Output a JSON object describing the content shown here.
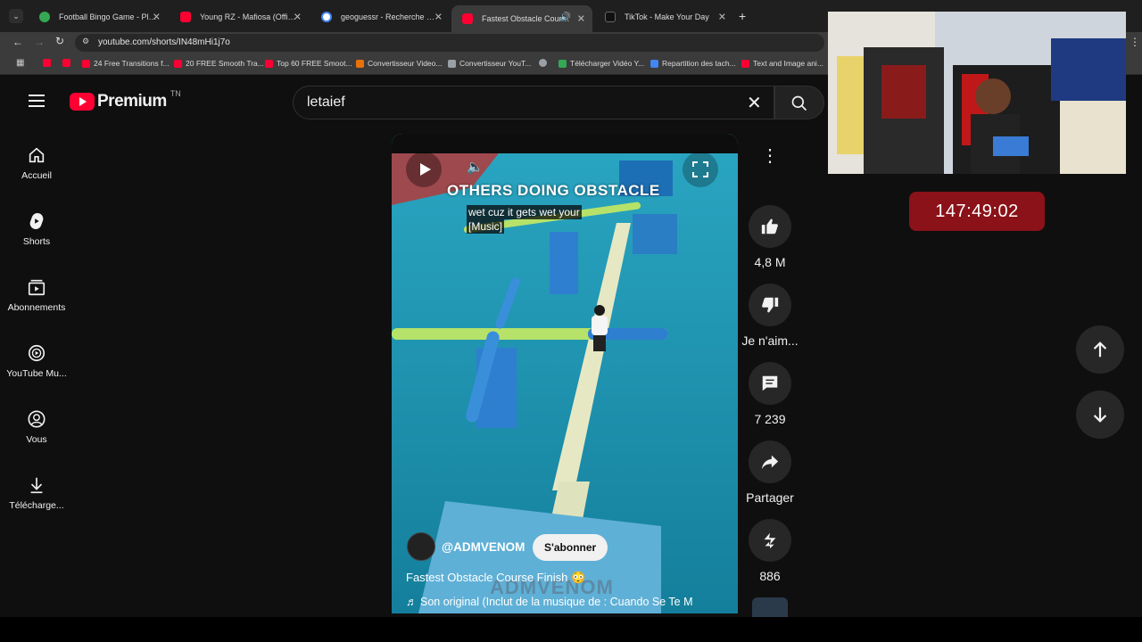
{
  "tabs": [
    {
      "label": "Football Bingo Game - Play No",
      "color": "#34a853"
    },
    {
      "label": "Young RZ - Mafiosa (Official M",
      "color": "#ff0033"
    },
    {
      "label": "geoguessr - Recherche Google",
      "color": "#4285f4"
    },
    {
      "label": "Fastest Obstacle Course Fini",
      "color": "#ff0033"
    },
    {
      "label": "TikTok - Make Your Day",
      "color": "#000000"
    }
  ],
  "address": {
    "url": "youtube.com/shorts/IN48mHi1j7o"
  },
  "bookmarks": [
    {
      "label": "",
      "color": "#ff0033"
    },
    {
      "label": "",
      "color": "#ff0033"
    },
    {
      "label": "24 Free Transitions f...",
      "color": "#ff0033"
    },
    {
      "label": "20 FREE Smooth Tra...",
      "color": "#ff0033"
    },
    {
      "label": "Top 60 FREE Smoot...",
      "color": "#ff0033"
    },
    {
      "label": "Convertisseur Video...",
      "color": "#e8710a"
    },
    {
      "label": "Convertisseur YouT...",
      "color": "#9aa0a6"
    },
    {
      "label": "",
      "color": "#9aa0a6"
    },
    {
      "label": "Télécharger Vidéo Y...",
      "color": "#34a853"
    },
    {
      "label": "Repartition des tach...",
      "color": "#4285f4"
    },
    {
      "label": "Text and Image ani...",
      "color": "#ff0033"
    }
  ],
  "youtube": {
    "logo_text": "Premium",
    "country": "TN",
    "search_value": "letaief",
    "nav": [
      {
        "label": "Accueil",
        "icon": "home-icon"
      },
      {
        "label": "Shorts",
        "icon": "shorts-icon"
      },
      {
        "label": "Abonnements",
        "icon": "subscriptions-icon"
      },
      {
        "label": "YouTube Mu...",
        "icon": "music-icon"
      },
      {
        "label": "Vous",
        "icon": "user-icon"
      },
      {
        "label": "Télécharge...",
        "icon": "download-icon"
      }
    ]
  },
  "video": {
    "overlay_title": "OTHERS DOING OBSTACLE",
    "caption_line1": "wet cuz it gets wet your",
    "caption_line2": "[Music]",
    "channel": "@ADMVENOM",
    "subscribe": "S'abonner",
    "title": "Fastest Obstacle Course Finish 😳",
    "music": "Son original (Inclut de la musique de : Cuando Se Te M",
    "watermark": "ADMVENOM"
  },
  "actions": {
    "likes": "4,8 M",
    "dislike": "Je n'aim...",
    "comments": "7 239",
    "share": "Partager",
    "remix": "886"
  },
  "timer": "147:49:02"
}
